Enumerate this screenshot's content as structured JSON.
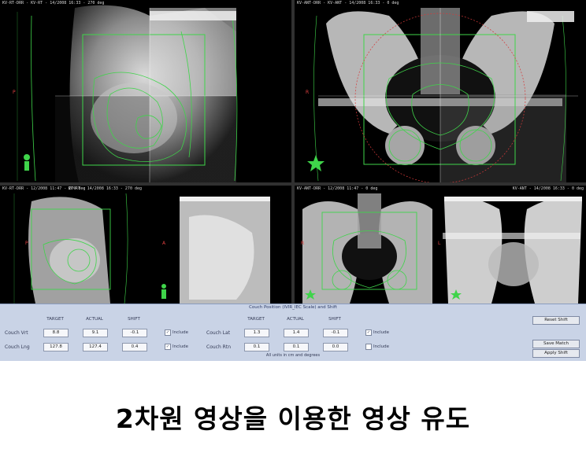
{
  "viewer": {
    "panes": [
      {
        "header": "KV-RT-DRR - KV-RT - 14/2008 16:33 - 270 deg"
      },
      {
        "header": "KV-ANT-DRR - KV-ANT - 14/2008 16:33 - 0 deg"
      },
      {
        "header": "KV-RT-DRR - 12/2008 11:47 - 270 deg",
        "header2": "KV-RT - 14/2008 16:33 - 270 deg"
      },
      {
        "header": "KV-ANT-DRR - 12/2008 11:47 - 0 deg",
        "header2": "KV-ANT - 14/2008 16:33 - 0 deg"
      }
    ],
    "orientation_letters": [
      "P",
      "A",
      "R",
      "L",
      "P",
      "A",
      "R",
      "L"
    ]
  },
  "couch_panel": {
    "title": "Couch Position (IVIR_IEC Scale) and Shift",
    "col_target": "TARGET",
    "col_actual": "ACTUAL",
    "col_shift": "SHIFT",
    "rows_left": [
      {
        "label": "Couch Vrt",
        "target": "8.8",
        "actual": "9.1",
        "shift": "-0.1",
        "include": "Include"
      },
      {
        "label": "Couch Lng",
        "target": "127.8",
        "actual": "127.4",
        "shift": "0.4",
        "include": "Include"
      }
    ],
    "rows_right": [
      {
        "label": "Couch Lat",
        "target": "1.3",
        "actual": "1.4",
        "shift": "-0.1",
        "include": "Include"
      },
      {
        "label": "Couch Rtn",
        "target": "0.1",
        "actual": "0.1",
        "shift": "0.0",
        "include": "Include"
      }
    ],
    "reset_label": "Reset Shift",
    "save_label": "Save Match",
    "apply_label": "Apply Shift",
    "units_note": "All units in cm and degrees"
  },
  "caption": "2차원 영상을 이용한 영상 유도",
  "colors": {
    "contour": "#3fd44a",
    "selected_outline": "#e6d26a",
    "panel_bg": "#c9d3e6"
  }
}
